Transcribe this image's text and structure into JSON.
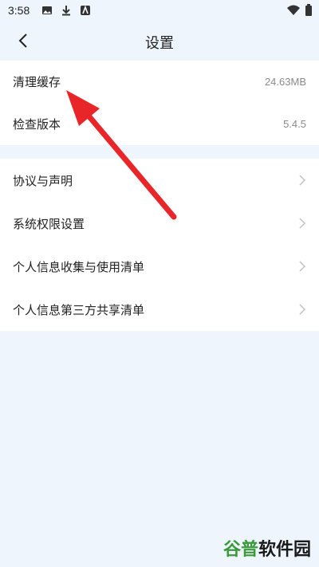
{
  "status_bar": {
    "time": "3:58",
    "left_icons": [
      "image-icon",
      "download-icon",
      "app-icon"
    ],
    "right_icons": [
      "wifi-icon",
      "battery-icon"
    ]
  },
  "header": {
    "title": "设置",
    "back_icon": "chevron-left-icon"
  },
  "group_info": {
    "items": [
      {
        "label": "清理缓存",
        "value": "24.63MB"
      },
      {
        "label": "检查版本",
        "value": "5.4.5"
      }
    ]
  },
  "group_links": {
    "items": [
      {
        "label": "协议与声明",
        "icon": "chevron-right-icon"
      },
      {
        "label": "系统权限设置",
        "icon": "chevron-right-icon"
      },
      {
        "label": "个人信息收集与使用清单",
        "icon": "chevron-right-icon"
      },
      {
        "label": "个人信息第三方共享清单",
        "icon": "chevron-right-icon"
      }
    ]
  },
  "annotation": {
    "color": "#e8262a",
    "icon": "red-arrow"
  },
  "watermark": {
    "part_a": "谷普",
    "part_b": "软件园",
    "color_a": "#3a9a3a",
    "color_b": "#1a1a1a"
  }
}
